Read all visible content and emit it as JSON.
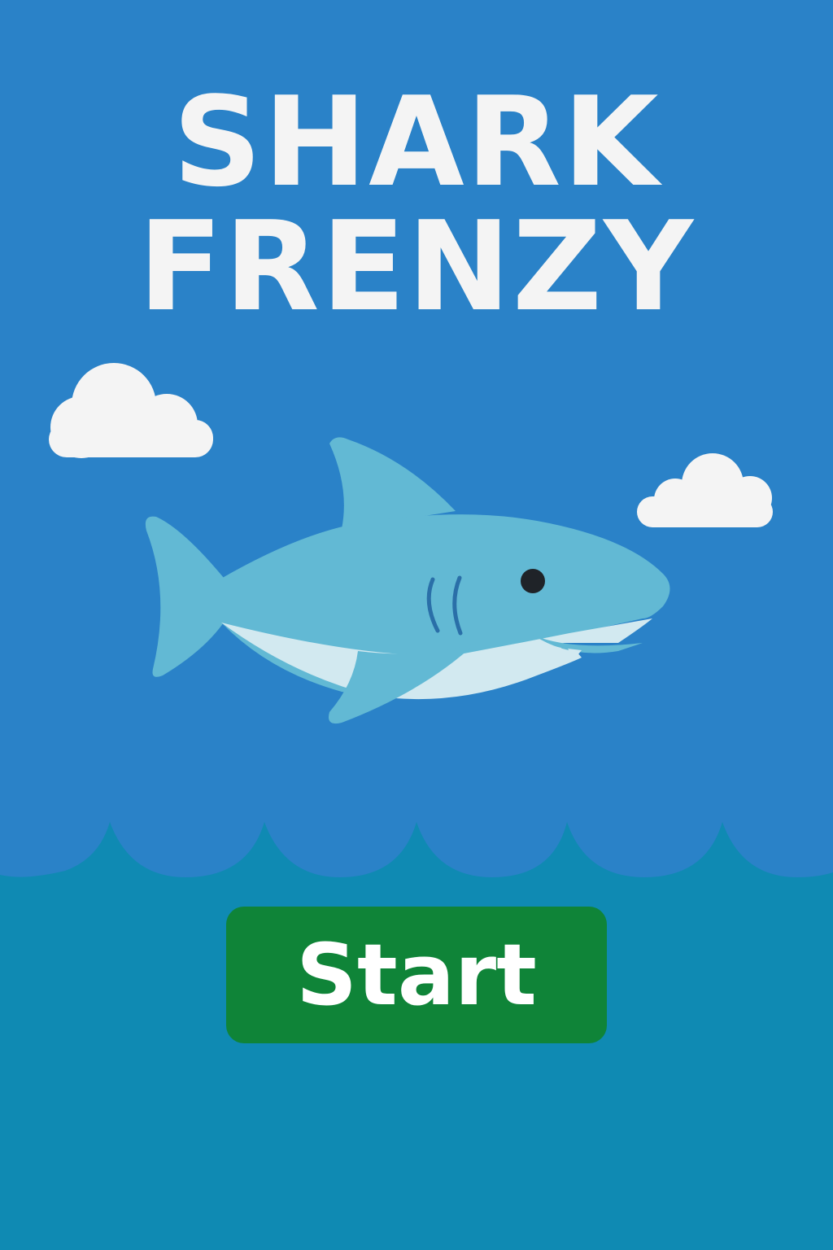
{
  "title": {
    "line1": "SHARK",
    "line2": "FRENZY"
  },
  "start_button": {
    "label": "Start"
  },
  "colors": {
    "sky": "#2a82c8",
    "water": "#0f8ab3",
    "title_text": "#f4f4f4",
    "cloud": "#f4f4f4",
    "shark_body": "#62b9d4",
    "shark_belly": "#d2e9f0",
    "shark_gills": "#2a6fa8",
    "shark_eye": "#1f2328",
    "button": "#0f8438",
    "button_text": "#ffffff"
  },
  "scene": {
    "icons": [
      "cloud-icon",
      "cloud-icon",
      "shark-icon"
    ]
  }
}
